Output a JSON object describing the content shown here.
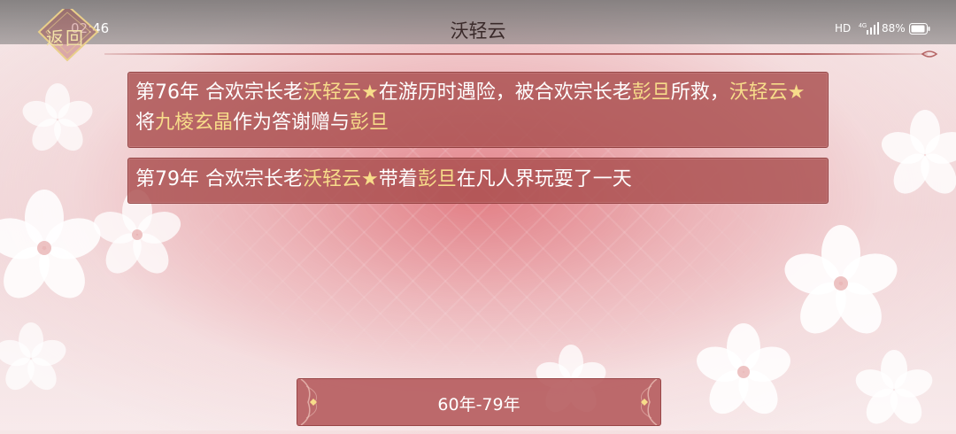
{
  "status_bar": {
    "time": "02:46",
    "hd": "HD",
    "network": "4G",
    "battery": "88%"
  },
  "header": {
    "title": "沃轻云",
    "back_label": "返回"
  },
  "events": [
    {
      "year": "第76年",
      "segments": [
        {
          "t": "合欢宗长老",
          "hl": false
        },
        {
          "t": "沃轻云★",
          "hl": true
        },
        {
          "t": "在游历时遇险，被合欢宗长老",
          "hl": false
        },
        {
          "t": "彭旦",
          "hl": true
        },
        {
          "t": "所救，",
          "hl": false
        },
        {
          "t": "沃轻云★",
          "hl": true
        },
        {
          "t": "将",
          "hl": false
        },
        {
          "t": "九棱玄晶",
          "hl": true
        },
        {
          "t": "作为答谢赠与",
          "hl": false
        },
        {
          "t": "彭旦",
          "hl": true
        }
      ]
    },
    {
      "year": "第79年",
      "segments": [
        {
          "t": "合欢宗长老",
          "hl": false
        },
        {
          "t": "沃轻云★",
          "hl": true
        },
        {
          "t": "带着",
          "hl": false
        },
        {
          "t": "彭旦",
          "hl": true
        },
        {
          "t": "在凡人界玩耍了一天",
          "hl": false
        }
      ]
    }
  ],
  "range_selector": {
    "label": "60年-79年"
  },
  "colors": {
    "highlight": "#f7dc8a",
    "card_bg": "#aa4e4e",
    "title_text": "#3a2a2a"
  }
}
